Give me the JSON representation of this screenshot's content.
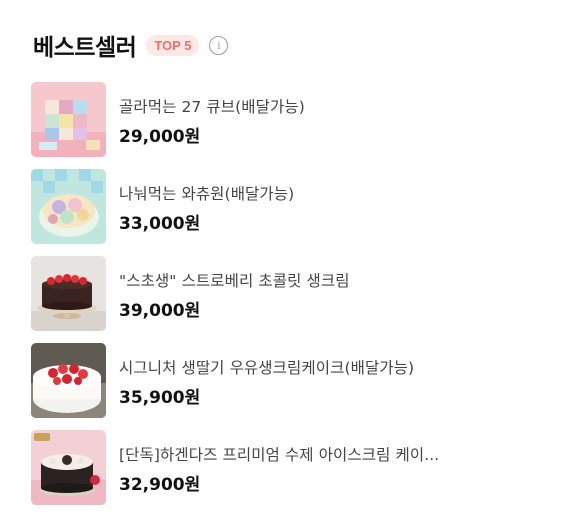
{
  "header": {
    "title": "베스트셀러",
    "badge": "TOP 5",
    "info_icon": "info-icon"
  },
  "items": [
    {
      "name": "골라먹는 27 큐브(배달가능)",
      "price": "29,000원",
      "image": "cube-cake-image"
    },
    {
      "name": "나눠먹는 와츄원(배달가능)",
      "price": "33,000원",
      "image": "wachu-one-cake-image"
    },
    {
      "name": "\"스초생\" 스트로베리 초콜릿 생크림",
      "price": "39,000원",
      "image": "strawberry-chocolate-cake-image"
    },
    {
      "name": "시그니처 생딸기 우유생크림케이크(배달가능)",
      "price": "35,900원",
      "image": "strawberry-cream-cake-image"
    },
    {
      "name": "[단독]하겐다즈 프리미엄 수제 아이스크림 케이...",
      "price": "32,900원",
      "image": "haagen-dazs-cake-image"
    }
  ]
}
